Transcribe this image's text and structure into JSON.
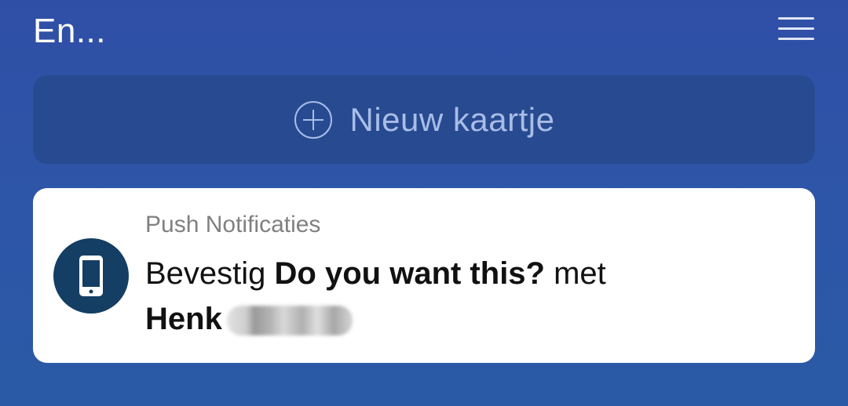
{
  "header": {
    "title": "En...",
    "menu_icon": "hamburger-menu-icon"
  },
  "new_card": {
    "icon": "plus-circle-icon",
    "label": "Nieuw kaartje"
  },
  "notification": {
    "icon": "mobile-phone-icon",
    "category": "Push Notificaties",
    "prefix": "Bevestig",
    "question": "Do you want this?",
    "suffix": "met",
    "name": "Henk"
  },
  "colors": {
    "background": "#2d56a8",
    "new_card_bg": "#274a91",
    "icon_circle": "#143e63"
  }
}
